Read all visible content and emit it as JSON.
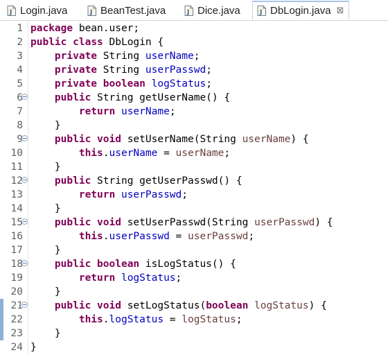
{
  "tabs": [
    {
      "label": "Login.java",
      "active": false
    },
    {
      "label": "BeanTest.java",
      "active": false
    },
    {
      "label": "Dice.java",
      "active": false
    },
    {
      "label": "DbLogin.java",
      "active": true
    }
  ],
  "close_glyph": "⊠",
  "colors": {
    "keyword": "#7f0055",
    "field": "#0000c0",
    "parameter": "#6a3e3e",
    "text": "#000000",
    "line_number": "#606060",
    "change_bar": "#8fb1d9"
  },
  "code_lines": [
    {
      "n": "1",
      "fold": false,
      "tokens": [
        {
          "t": "kw",
          "v": "package"
        },
        {
          "t": "plain",
          "v": " bean.user;"
        }
      ]
    },
    {
      "n": "2",
      "fold": false,
      "tokens": [
        {
          "t": "kw",
          "v": "public"
        },
        {
          "t": "plain",
          "v": " "
        },
        {
          "t": "kw",
          "v": "class"
        },
        {
          "t": "plain",
          "v": " DbLogin {"
        }
      ]
    },
    {
      "n": "3",
      "fold": false,
      "tokens": [
        {
          "t": "plain",
          "v": "    "
        },
        {
          "t": "kw",
          "v": "private"
        },
        {
          "t": "plain",
          "v": " String "
        },
        {
          "t": "fld",
          "v": "userName"
        },
        {
          "t": "plain",
          "v": ";"
        }
      ]
    },
    {
      "n": "4",
      "fold": false,
      "tokens": [
        {
          "t": "plain",
          "v": "    "
        },
        {
          "t": "kw",
          "v": "private"
        },
        {
          "t": "plain",
          "v": " String "
        },
        {
          "t": "fld",
          "v": "userPasswd"
        },
        {
          "t": "plain",
          "v": ";"
        }
      ]
    },
    {
      "n": "5",
      "fold": false,
      "tokens": [
        {
          "t": "plain",
          "v": "    "
        },
        {
          "t": "kw",
          "v": "private"
        },
        {
          "t": "plain",
          "v": " "
        },
        {
          "t": "kw",
          "v": "boolean"
        },
        {
          "t": "plain",
          "v": " "
        },
        {
          "t": "fld",
          "v": "logStatus"
        },
        {
          "t": "plain",
          "v": ";"
        }
      ]
    },
    {
      "n": "6",
      "fold": true,
      "tokens": [
        {
          "t": "plain",
          "v": "    "
        },
        {
          "t": "kw",
          "v": "public"
        },
        {
          "t": "plain",
          "v": " String getUserName() {"
        }
      ]
    },
    {
      "n": "7",
      "fold": false,
      "tokens": [
        {
          "t": "plain",
          "v": "        "
        },
        {
          "t": "kw",
          "v": "return"
        },
        {
          "t": "plain",
          "v": " "
        },
        {
          "t": "fld",
          "v": "userName"
        },
        {
          "t": "plain",
          "v": ";"
        }
      ]
    },
    {
      "n": "8",
      "fold": false,
      "tokens": [
        {
          "t": "plain",
          "v": "    }"
        }
      ]
    },
    {
      "n": "9",
      "fold": true,
      "tokens": [
        {
          "t": "plain",
          "v": "    "
        },
        {
          "t": "kw",
          "v": "public"
        },
        {
          "t": "plain",
          "v": " "
        },
        {
          "t": "kw",
          "v": "void"
        },
        {
          "t": "plain",
          "v": " setUserName(String "
        },
        {
          "t": "prm",
          "v": "userName"
        },
        {
          "t": "plain",
          "v": ") {"
        }
      ]
    },
    {
      "n": "10",
      "fold": false,
      "tokens": [
        {
          "t": "plain",
          "v": "        "
        },
        {
          "t": "kw",
          "v": "this"
        },
        {
          "t": "plain",
          "v": "."
        },
        {
          "t": "fld",
          "v": "userName"
        },
        {
          "t": "plain",
          "v": " = "
        },
        {
          "t": "prm",
          "v": "userName"
        },
        {
          "t": "plain",
          "v": ";"
        }
      ]
    },
    {
      "n": "11",
      "fold": false,
      "tokens": [
        {
          "t": "plain",
          "v": "    }"
        }
      ]
    },
    {
      "n": "12",
      "fold": true,
      "tokens": [
        {
          "t": "plain",
          "v": "    "
        },
        {
          "t": "kw",
          "v": "public"
        },
        {
          "t": "plain",
          "v": " String getUserPasswd() {"
        }
      ]
    },
    {
      "n": "13",
      "fold": false,
      "tokens": [
        {
          "t": "plain",
          "v": "        "
        },
        {
          "t": "kw",
          "v": "return"
        },
        {
          "t": "plain",
          "v": " "
        },
        {
          "t": "fld",
          "v": "userPasswd"
        },
        {
          "t": "plain",
          "v": ";"
        }
      ]
    },
    {
      "n": "14",
      "fold": false,
      "tokens": [
        {
          "t": "plain",
          "v": "    }"
        }
      ]
    },
    {
      "n": "15",
      "fold": true,
      "tokens": [
        {
          "t": "plain",
          "v": "    "
        },
        {
          "t": "kw",
          "v": "public"
        },
        {
          "t": "plain",
          "v": " "
        },
        {
          "t": "kw",
          "v": "void"
        },
        {
          "t": "plain",
          "v": " setUserPasswd(String "
        },
        {
          "t": "prm",
          "v": "userPasswd"
        },
        {
          "t": "plain",
          "v": ") {"
        }
      ]
    },
    {
      "n": "16",
      "fold": false,
      "tokens": [
        {
          "t": "plain",
          "v": "        "
        },
        {
          "t": "kw",
          "v": "this"
        },
        {
          "t": "plain",
          "v": "."
        },
        {
          "t": "fld",
          "v": "userPasswd"
        },
        {
          "t": "plain",
          "v": " = "
        },
        {
          "t": "prm",
          "v": "userPasswd"
        },
        {
          "t": "plain",
          "v": ";"
        }
      ]
    },
    {
      "n": "17",
      "fold": false,
      "tokens": [
        {
          "t": "plain",
          "v": "    }"
        }
      ]
    },
    {
      "n": "18",
      "fold": true,
      "tokens": [
        {
          "t": "plain",
          "v": "    "
        },
        {
          "t": "kw",
          "v": "public"
        },
        {
          "t": "plain",
          "v": " "
        },
        {
          "t": "kw",
          "v": "boolean"
        },
        {
          "t": "plain",
          "v": " isLogStatus() {"
        }
      ]
    },
    {
      "n": "19",
      "fold": false,
      "tokens": [
        {
          "t": "plain",
          "v": "        "
        },
        {
          "t": "kw",
          "v": "return"
        },
        {
          "t": "plain",
          "v": " "
        },
        {
          "t": "fld",
          "v": "logStatus"
        },
        {
          "t": "plain",
          "v": ";"
        }
      ]
    },
    {
      "n": "20",
      "fold": false,
      "tokens": [
        {
          "t": "plain",
          "v": "    }"
        }
      ]
    },
    {
      "n": "21",
      "fold": true,
      "changed": true,
      "tokens": [
        {
          "t": "plain",
          "v": "    "
        },
        {
          "t": "kw",
          "v": "public"
        },
        {
          "t": "plain",
          "v": " "
        },
        {
          "t": "kw",
          "v": "void"
        },
        {
          "t": "plain",
          "v": " setLogStatus("
        },
        {
          "t": "kw",
          "v": "boolean"
        },
        {
          "t": "plain",
          "v": " "
        },
        {
          "t": "prm",
          "v": "logStatus"
        },
        {
          "t": "plain",
          "v": ") {"
        }
      ]
    },
    {
      "n": "22",
      "fold": false,
      "changed": true,
      "tokens": [
        {
          "t": "plain",
          "v": "        "
        },
        {
          "t": "kw",
          "v": "this"
        },
        {
          "t": "plain",
          "v": "."
        },
        {
          "t": "fld",
          "v": "logStatus"
        },
        {
          "t": "plain",
          "v": " = "
        },
        {
          "t": "prm",
          "v": "logStatus"
        },
        {
          "t": "plain",
          "v": ";"
        }
      ]
    },
    {
      "n": "23",
      "fold": false,
      "changed": true,
      "tokens": [
        {
          "t": "plain",
          "v": "    }"
        }
      ]
    },
    {
      "n": "24",
      "fold": false,
      "tokens": [
        {
          "t": "plain",
          "v": "}"
        }
      ]
    }
  ]
}
